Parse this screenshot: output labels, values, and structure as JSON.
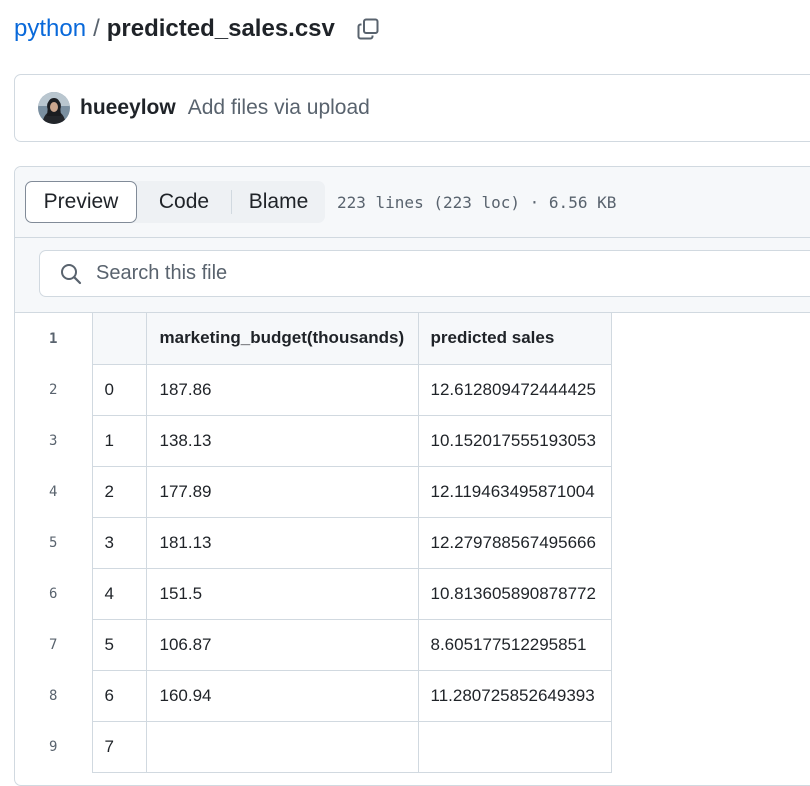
{
  "breadcrumb": {
    "repo": "python",
    "separator": "/",
    "file": "predicted_sales.csv"
  },
  "commit": {
    "author": "hueeylow",
    "message": "Add files via upload"
  },
  "file_header": {
    "tabs": [
      "Preview",
      "Code",
      "Blame"
    ],
    "active_tab": "Preview",
    "info": "223 lines (223 loc) · 6.56 KB"
  },
  "search": {
    "placeholder": "Search this file"
  },
  "table": {
    "header_line": "1",
    "columns": [
      "",
      "marketing_budget(thousands)",
      "predicted sales"
    ],
    "rows": [
      {
        "line": "2",
        "cells": [
          "0",
          "187.86",
          "12.612809472444425"
        ]
      },
      {
        "line": "3",
        "cells": [
          "1",
          "138.13",
          "10.152017555193053"
        ]
      },
      {
        "line": "4",
        "cells": [
          "2",
          "177.89",
          "12.119463495871004"
        ]
      },
      {
        "line": "5",
        "cells": [
          "3",
          "181.13",
          "12.279788567495666"
        ]
      },
      {
        "line": "6",
        "cells": [
          "4",
          "151.5",
          "10.813605890878772"
        ]
      },
      {
        "line": "7",
        "cells": [
          "5",
          "106.87",
          "8.605177512295851"
        ]
      },
      {
        "line": "8",
        "cells": [
          "6",
          "160.94",
          "11.280725852649393"
        ]
      },
      {
        "line": "9",
        "cells": [
          "7",
          "",
          ""
        ]
      }
    ]
  },
  "icons": {
    "copy": "copy-icon",
    "avatar": "avatar-image",
    "search": "search-icon"
  },
  "colors": {
    "link": "#0969da",
    "muted": "#59636e",
    "border": "#d1d9e0",
    "header_bg": "#f6f8fa"
  }
}
